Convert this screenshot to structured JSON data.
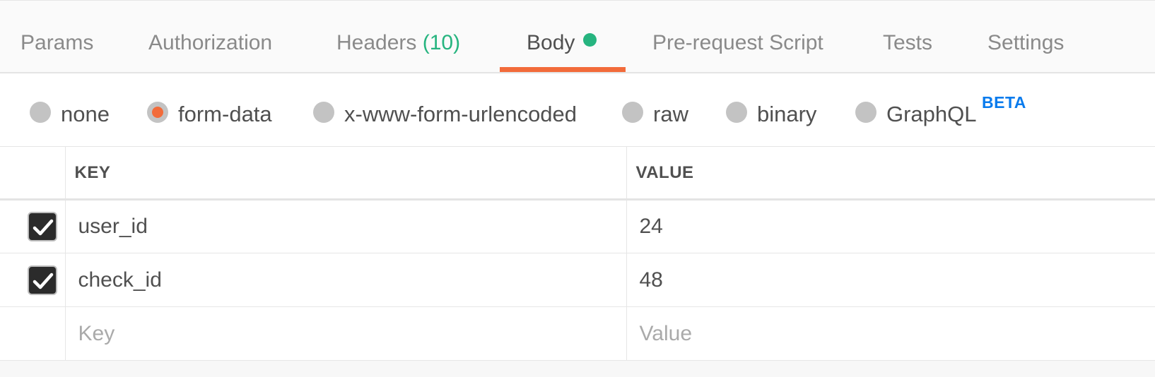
{
  "tabs": [
    {
      "label": "Params"
    },
    {
      "label": "Authorization"
    },
    {
      "label": "Headers",
      "count": "(10)"
    },
    {
      "label": "Body",
      "indicator": "dot"
    },
    {
      "label": "Pre-request Script"
    },
    {
      "label": "Tests"
    },
    {
      "label": "Settings"
    }
  ],
  "active_tab": "Body",
  "body_types": {
    "options": [
      "none",
      "form-data",
      "x-www-form-urlencoded",
      "raw",
      "binary",
      "GraphQL"
    ],
    "selected": "form-data",
    "graphql_badge": "BETA"
  },
  "table": {
    "headers": {
      "key": "KEY",
      "value": "VALUE"
    },
    "rows": [
      {
        "checked": true,
        "key": "user_id",
        "value": "24"
      },
      {
        "checked": true,
        "key": "check_id",
        "value": "48"
      }
    ],
    "new_row": {
      "key_placeholder": "Key",
      "value_placeholder": "Value"
    }
  },
  "colors": {
    "accent": "#f26b3a",
    "count_green": "#26b47f",
    "beta_blue": "#097bed"
  }
}
